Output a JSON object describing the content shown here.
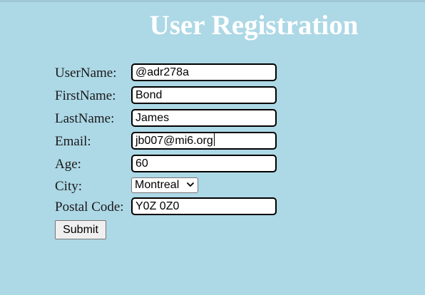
{
  "page": {
    "title": "User Registration"
  },
  "form": {
    "username": {
      "label": "UserName:",
      "value": "@adr278a"
    },
    "firstname": {
      "label": "FirstName:",
      "value": "Bond"
    },
    "lastname": {
      "label": "LastName:",
      "value": "James"
    },
    "email": {
      "label": "Email:",
      "value": "jb007@mi6.org"
    },
    "age": {
      "label": "Age:",
      "value": "60"
    },
    "city": {
      "label": "City:",
      "selected": "Montreal"
    },
    "postal": {
      "label": "Postal Code:",
      "value": "Y0Z 0Z0"
    },
    "submit_label": "Submit"
  },
  "icons": {
    "city_dropdown": "chevron-down-icon"
  },
  "colors": {
    "background": "#add8e6",
    "title": "#ffffff",
    "field_border": "#000000"
  }
}
